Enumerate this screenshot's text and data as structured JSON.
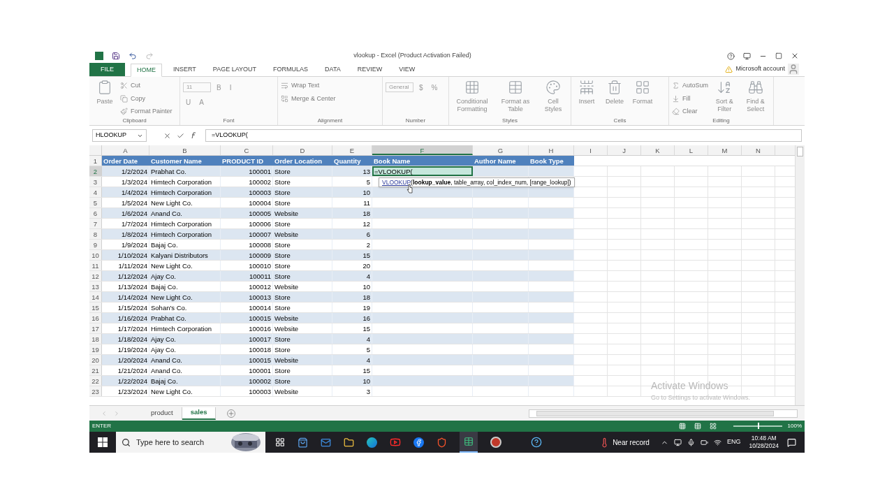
{
  "window": {
    "title": "vlookup - Excel (Product Activation Failed)"
  },
  "ribbon_tabs": [
    {
      "label": "FILE",
      "kind": "file",
      "selected": false
    },
    {
      "label": "HOME",
      "kind": "tab",
      "selected": true
    },
    {
      "label": "INSERT",
      "kind": "tab",
      "selected": false
    },
    {
      "label": "PAGE LAYOUT",
      "kind": "tab",
      "selected": false
    },
    {
      "label": "FORMULAS",
      "kind": "tab",
      "selected": false
    },
    {
      "label": "DATA",
      "kind": "tab",
      "selected": false
    },
    {
      "label": "REVIEW",
      "kind": "tab",
      "selected": false
    },
    {
      "label": "VIEW",
      "kind": "tab",
      "selected": false
    }
  ],
  "account": {
    "label": "Microsoft account"
  },
  "ribbon_groups": [
    {
      "title": "Clipboard",
      "items": [
        {
          "label": "Paste",
          "kind": "large"
        },
        {
          "label": "Cut",
          "kind": "small"
        },
        {
          "label": "Copy",
          "kind": "small"
        },
        {
          "label": "Format Painter",
          "kind": "small"
        }
      ]
    },
    {
      "title": "Font",
      "items": [
        {
          "label": "11",
          "kind": "fontbox"
        },
        {
          "label": "B",
          "kind": "glyph"
        },
        {
          "label": "I",
          "kind": "glyph"
        },
        {
          "label": "U",
          "kind": "glyph"
        },
        {
          "label": "A",
          "kind": "glyph"
        }
      ]
    },
    {
      "title": "Alignment",
      "items": [
        {
          "label": "Wrap Text",
          "kind": "small"
        },
        {
          "label": "Merge & Center",
          "kind": "small"
        }
      ]
    },
    {
      "title": "Number",
      "items": [
        {
          "label": "General",
          "kind": "fontbox"
        },
        {
          "label": "$",
          "kind": "glyph"
        },
        {
          "label": "%",
          "kind": "glyph"
        }
      ]
    },
    {
      "title": "Styles",
      "items": [
        {
          "label": "Conditional Formatting",
          "kind": "large"
        },
        {
          "label": "Format as Table",
          "kind": "large"
        },
        {
          "label": "Cell Styles",
          "kind": "large"
        }
      ]
    },
    {
      "title": "Cells",
      "items": [
        {
          "label": "Insert",
          "kind": "large"
        },
        {
          "label": "Delete",
          "kind": "large"
        },
        {
          "label": "Format",
          "kind": "large"
        }
      ]
    },
    {
      "title": "Editing",
      "items": [
        {
          "label": "AutoSum",
          "kind": "small"
        },
        {
          "label": "Fill",
          "kind": "small"
        },
        {
          "label": "Clear",
          "kind": "small"
        },
        {
          "label": "Sort & Filter",
          "kind": "large"
        },
        {
          "label": "Find & Select",
          "kind": "large"
        }
      ]
    }
  ],
  "name_box": "HLOOKUP",
  "formula": "=VLOOKUP(",
  "columns": [
    {
      "label": "A",
      "selected": false
    },
    {
      "label": "B",
      "selected": false
    },
    {
      "label": "C",
      "selected": false
    },
    {
      "label": "D",
      "selected": false
    },
    {
      "label": "E",
      "selected": false
    },
    {
      "label": "F",
      "selected": true
    },
    {
      "label": "G",
      "selected": false
    },
    {
      "label": "H",
      "selected": false
    },
    {
      "label": "I",
      "selected": false
    },
    {
      "label": "J",
      "selected": false
    },
    {
      "label": "K",
      "selected": false
    },
    {
      "label": "L",
      "selected": false
    },
    {
      "label": "M",
      "selected": false
    },
    {
      "label": "N",
      "selected": false
    }
  ],
  "header_row": {
    "num": "1",
    "headings": [
      "Order Date",
      "Customer Name",
      "PRODUCT ID",
      "Order Location",
      "Quantity",
      "Book Name",
      "Author Name",
      "Book Type"
    ]
  },
  "rows": [
    {
      "num": "2",
      "selected": true,
      "values": [
        "1/2/2024",
        "Prabhat Co.",
        "100001",
        "Store",
        "13"
      ],
      "editing": "=VLOOKUP("
    },
    {
      "num": "3",
      "selected": false,
      "values": [
        "1/3/2024",
        "Himtech Corporation",
        "100002",
        "Store",
        "5"
      ]
    },
    {
      "num": "4",
      "selected": false,
      "values": [
        "1/4/2024",
        "Himtech Corporation",
        "100003",
        "Store",
        "10"
      ]
    },
    {
      "num": "5",
      "selected": false,
      "values": [
        "1/5/2024",
        "New Light Co.",
        "100004",
        "Store",
        "11"
      ]
    },
    {
      "num": "6",
      "selected": false,
      "values": [
        "1/6/2024",
        "Anand Co.",
        "100005",
        "Website",
        "18"
      ]
    },
    {
      "num": "7",
      "selected": false,
      "values": [
        "1/7/2024",
        "Himtech Corporation",
        "100006",
        "Store",
        "12"
      ]
    },
    {
      "num": "8",
      "selected": false,
      "values": [
        "1/8/2024",
        "Himtech Corporation",
        "100007",
        "Website",
        "6"
      ]
    },
    {
      "num": "9",
      "selected": false,
      "values": [
        "1/9/2024",
        "Bajaj Co.",
        "100008",
        "Store",
        "2"
      ]
    },
    {
      "num": "10",
      "selected": false,
      "values": [
        "1/10/2024",
        "Kalyani Distributors",
        "100009",
        "Store",
        "15"
      ]
    },
    {
      "num": "11",
      "selected": false,
      "values": [
        "1/11/2024",
        "New Light Co.",
        "100010",
        "Store",
        "20"
      ]
    },
    {
      "num": "12",
      "selected": false,
      "values": [
        "1/12/2024",
        "Ajay Co.",
        "100011",
        "Store",
        "4"
      ]
    },
    {
      "num": "13",
      "selected": false,
      "values": [
        "1/13/2024",
        "Bajaj Co.",
        "100012",
        "Website",
        "10"
      ]
    },
    {
      "num": "14",
      "selected": false,
      "values": [
        "1/14/2024",
        "New Light Co.",
        "100013",
        "Store",
        "18"
      ]
    },
    {
      "num": "15",
      "selected": false,
      "values": [
        "1/15/2024",
        "Sohan's Co.",
        "100014",
        "Store",
        "19"
      ]
    },
    {
      "num": "16",
      "selected": false,
      "values": [
        "1/16/2024",
        "Prabhat Co.",
        "100015",
        "Website",
        "16"
      ]
    },
    {
      "num": "17",
      "selected": false,
      "values": [
        "1/17/2024",
        "Himtech Corporation",
        "100016",
        "Website",
        "15"
      ]
    },
    {
      "num": "18",
      "selected": false,
      "values": [
        "1/18/2024",
        "Ajay Co.",
        "100017",
        "Store",
        "4"
      ]
    },
    {
      "num": "19",
      "selected": false,
      "values": [
        "1/19/2024",
        "Ajay Co.",
        "100018",
        "Store",
        "5"
      ]
    },
    {
      "num": "20",
      "selected": false,
      "values": [
        "1/20/2024",
        "Anand Co.",
        "100015",
        "Website",
        "4"
      ]
    },
    {
      "num": "21",
      "selected": false,
      "values": [
        "1/21/2024",
        "Anand Co.",
        "100001",
        "Store",
        "15"
      ]
    },
    {
      "num": "22",
      "selected": false,
      "values": [
        "1/22/2024",
        "Bajaj Co.",
        "100002",
        "Store",
        "10"
      ]
    },
    {
      "num": "23",
      "selected": false,
      "values": [
        "1/23/2024",
        "New Light Co.",
        "100003",
        "Website",
        "3"
      ]
    }
  ],
  "tooltip": {
    "function": "VLOOKUP",
    "signature": "(**lookup_value**, table_array, col_index_num, [range_lookup])"
  },
  "activation": {
    "title": "Activate Windows",
    "hint": "Go to Settings to activate Windows."
  },
  "sheets": [
    {
      "label": "product",
      "selected": false
    },
    {
      "label": "sales",
      "selected": true
    }
  ],
  "status": {
    "mode": "ENTER",
    "zoom": {
      "level": 0.5,
      "reading": "100%"
    }
  },
  "taskbar": {
    "search_placeholder": "Type here to search",
    "weather": "Near record",
    "language": "ENG",
    "time": "10:48 AM",
    "date": "10/28/2024"
  }
}
